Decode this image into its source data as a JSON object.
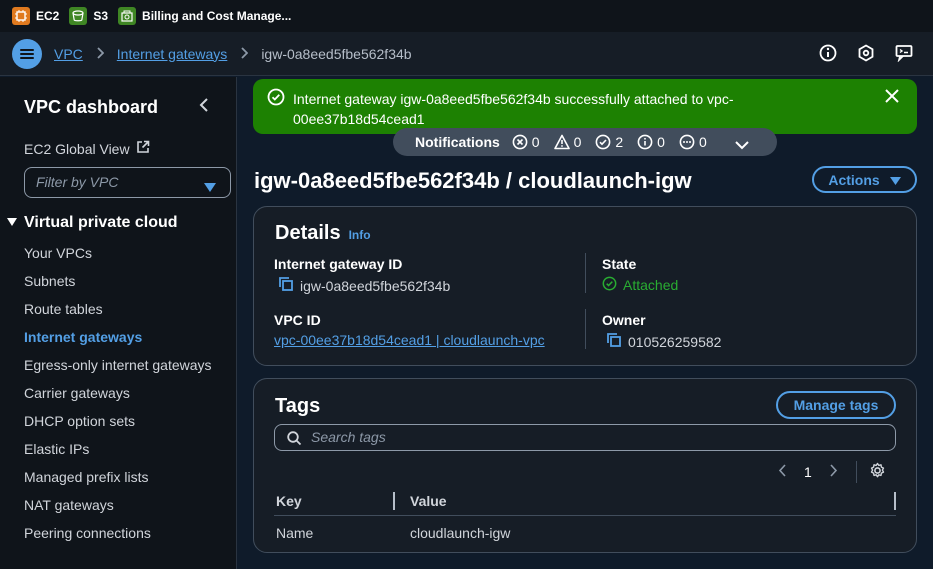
{
  "services": [
    {
      "label": "EC2",
      "icon": "ec2-icon"
    },
    {
      "label": "S3",
      "icon": "s3-icon"
    },
    {
      "label": "Billing and Cost Manage...",
      "icon": "billing-icon"
    }
  ],
  "breadcrumb": {
    "items": [
      "VPC",
      "Internet gateways",
      "igw-0a8eed5fbe562f34b"
    ]
  },
  "top_icons": [
    "info-icon",
    "settings-icon",
    "feedback-icon"
  ],
  "sidebar": {
    "title": "VPC dashboard",
    "global_view": "EC2 Global View",
    "filter_placeholder": "Filter by VPC",
    "section": "Virtual private cloud",
    "items": [
      {
        "label": "Your VPCs"
      },
      {
        "label": "Subnets"
      },
      {
        "label": "Route tables"
      },
      {
        "label": "Internet gateways",
        "active": true
      },
      {
        "label": "Egress-only internet gateways"
      },
      {
        "label": "Carrier gateways"
      },
      {
        "label": "DHCP option sets"
      },
      {
        "label": "Elastic IPs"
      },
      {
        "label": "Managed prefix lists"
      },
      {
        "label": "NAT gateways"
      },
      {
        "label": "Peering connections"
      }
    ]
  },
  "banner": {
    "message": "Internet gateway igw-0a8eed5fbe562f34b successfully attached to vpc-00ee37b18d54cead1",
    "color": "#1d8102"
  },
  "notifications": {
    "label": "Notifications",
    "error": "0",
    "warning": "0",
    "success": "2",
    "info": "0",
    "in_progress": "0"
  },
  "page": {
    "title": "igw-0a8eed5fbe562f34b / cloudlaunch-igw",
    "actions_label": "Actions"
  },
  "details": {
    "title": "Details",
    "info_label": "Info",
    "igw_id_label": "Internet gateway ID",
    "igw_id_value": "igw-0a8eed5fbe562f34b",
    "state_label": "State",
    "state_value": "Attached",
    "vpc_id_label": "VPC ID",
    "vpc_id_value": "vpc-00ee37b18d54cead1 | cloudlaunch-vpc",
    "owner_label": "Owner",
    "owner_value": "010526259582"
  },
  "tags": {
    "title": "Tags",
    "manage_label": "Manage tags",
    "search_placeholder": "Search tags",
    "page_number": "1",
    "columns": [
      "Key",
      "Value"
    ],
    "rows": [
      {
        "key": "Name",
        "value": "cloudlaunch-igw"
      }
    ]
  },
  "colors": {
    "accent": "#539fe5",
    "success": "#29ad32",
    "banner_green": "#1d8102",
    "background": "#0f1b2a"
  }
}
